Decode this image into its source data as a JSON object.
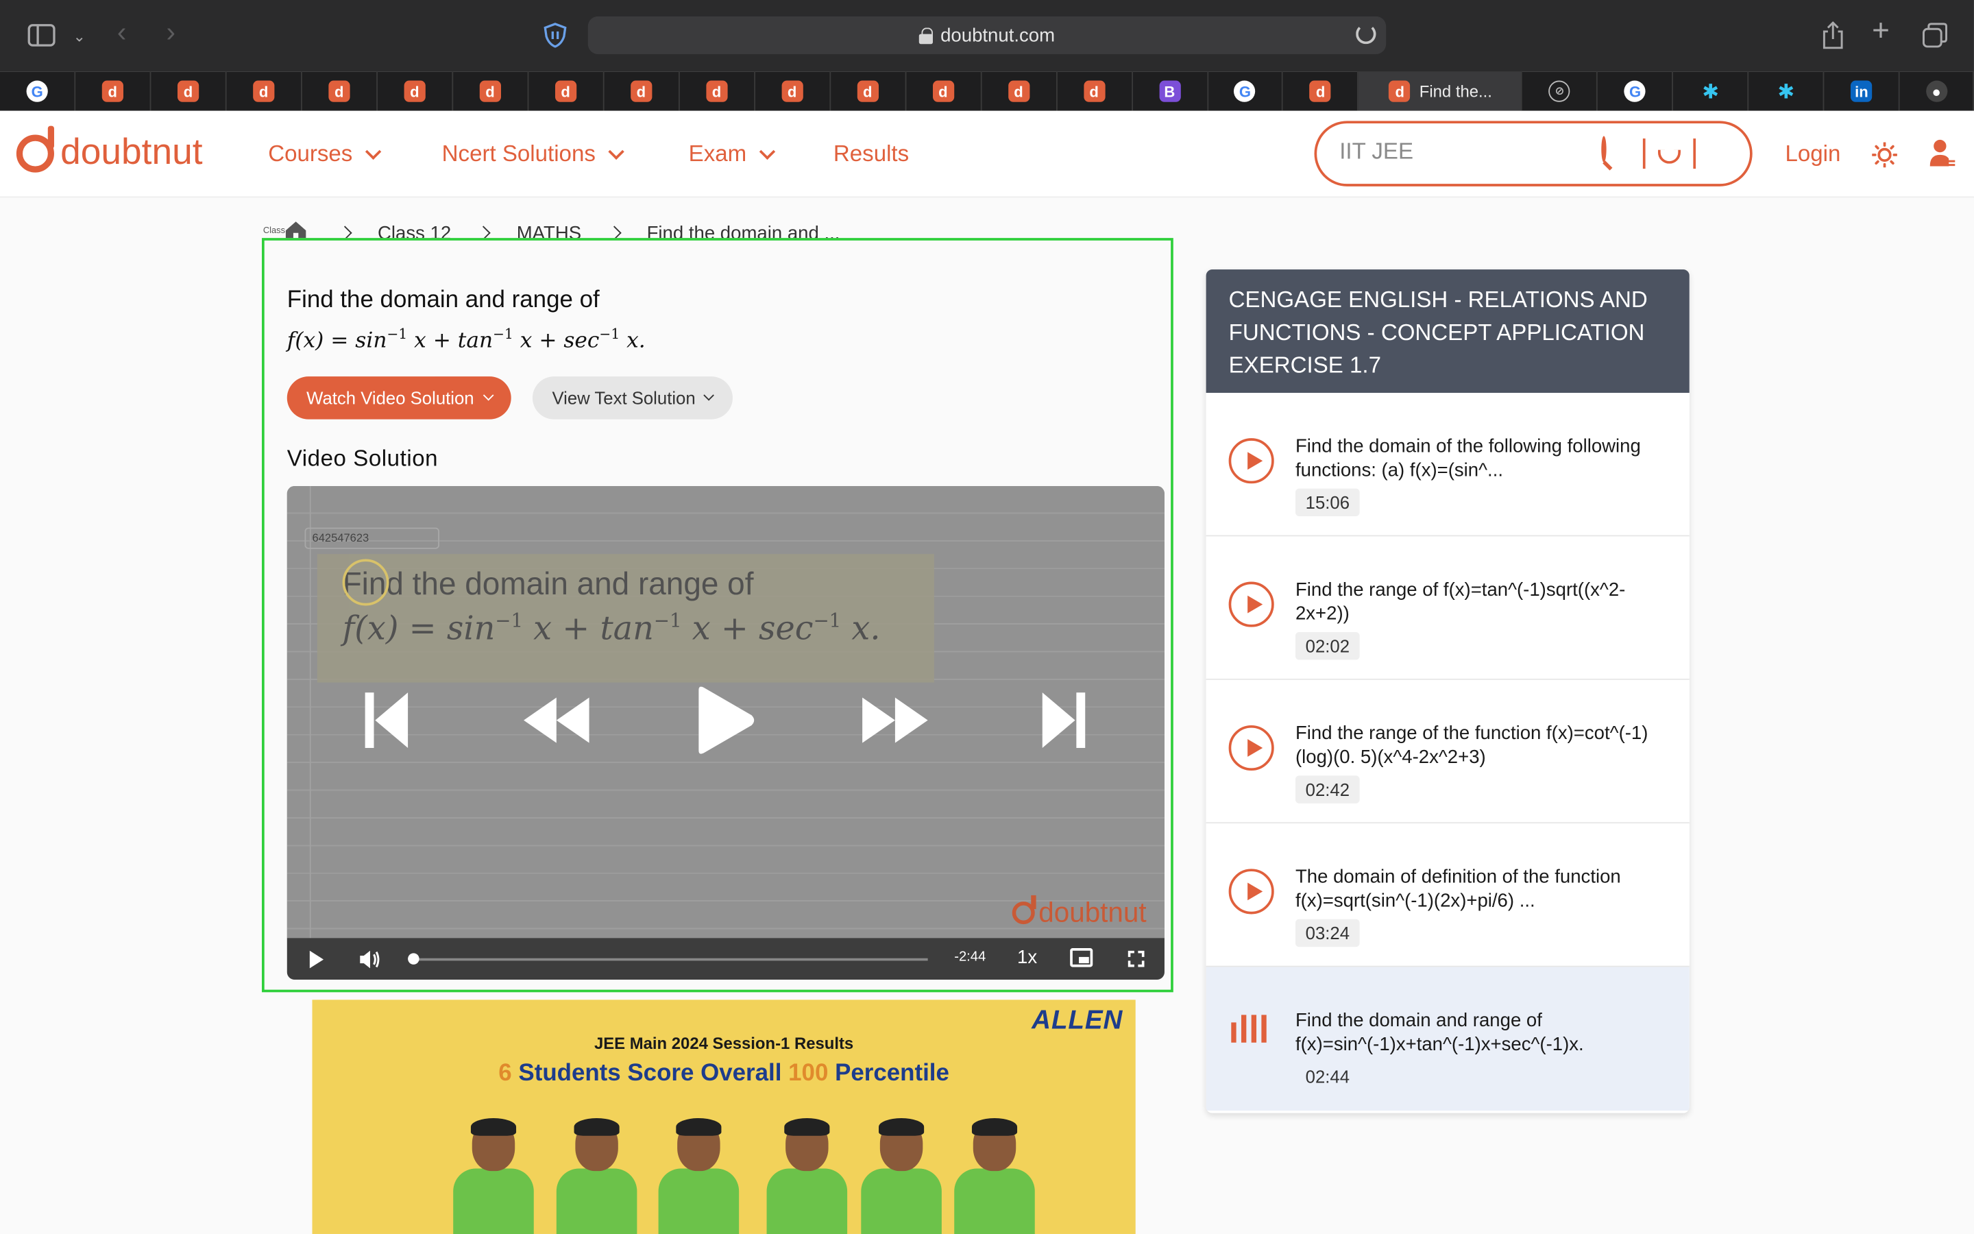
{
  "browser": {
    "url": "doubtnut.com",
    "active_tab_title": "Find the...",
    "tab_icons": [
      "google",
      "doubtnut",
      "doubtnut",
      "doubtnut",
      "doubtnut",
      "doubtnut",
      "doubtnut",
      "doubtnut",
      "doubtnut",
      "doubtnut",
      "doubtnut",
      "doubtnut",
      "doubtnut",
      "doubtnut",
      "doubtnut",
      "bootstrap",
      "google",
      "doubtnut"
    ],
    "tab_icons_after": [
      "safari-compass",
      "google",
      "slack",
      "slack",
      "linkedin",
      "github"
    ]
  },
  "site": {
    "logo_text": "doubtnut",
    "nav": {
      "courses": "Courses",
      "ncert": "Ncert Solutions",
      "exam": "Exam",
      "results": "Results"
    },
    "search_placeholder": "IIT JEE",
    "login": "Login"
  },
  "breadcrumb": {
    "home_label": "Class",
    "class": "Class 12",
    "subject": "MATHS",
    "current": "Find the domain and ..."
  },
  "question": {
    "title": "Find the domain and range of",
    "math_fx": "f(x) = sin",
    "math_inv": "−1",
    "math_x_tan": "x + tan",
    "math_x_sec": "x + sec",
    "math_x_end": "x.",
    "watch_label": "Watch Video Solution",
    "text_label": "View Text Solution",
    "video_section": "Video Solution"
  },
  "video": {
    "id": "642547623",
    "overlay_title": "Find the domain and range of",
    "watermark": "doubtnut",
    "time_remaining": "-2:44",
    "speed": "1x",
    "progress": 0
  },
  "ad": {
    "brand": "ALLEN",
    "line1": "JEE Main 2024 Session-1 Results",
    "line2_num1": "6",
    "line2_a": " Students Score Overall ",
    "line2_num2": "100",
    "line2_b": " Percentile"
  },
  "sidebar": {
    "header": "CENGAGE ENGLISH  -  RELATIONS AND FUNCTIONS  -  CONCEPT APPLICATION EXERCISE 1.7",
    "items": [
      {
        "text": "Find the domain of the following following functions: (a) f(x)=(sin^...",
        "duration": "15:06"
      },
      {
        "text": "Find the range of f(x)=tan^(-1)sqrt((x^2-2x+2))",
        "duration": "02:02"
      },
      {
        "text": "Find the range of the function f(x)=cot^(-1)(log)(0. 5)(x^4-2x^2+3)",
        "duration": "02:42"
      },
      {
        "text": "The domain of definition of the function f(x)=sqrt(sin^(-1)(2x)+pi/6) ...",
        "duration": "03:24"
      },
      {
        "text": "Find the domain and range of f(x)=sin^(-1)x+tan^(-1)x+sec^(-1)x.",
        "duration": "02:44"
      }
    ]
  },
  "colors": {
    "brand": "#e0603c",
    "highlight_border": "#2ecf3a",
    "sidebar_header": "#4c5361",
    "current_item_bg": "#eaeff8"
  }
}
